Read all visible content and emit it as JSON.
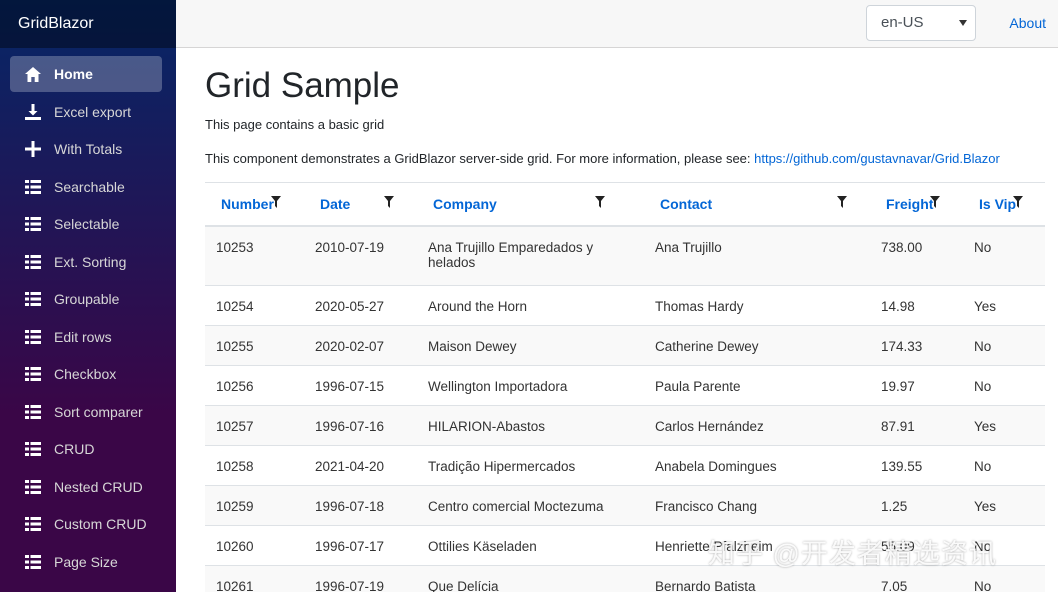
{
  "app": {
    "brand": "GridBlazor"
  },
  "sidebar": {
    "items": [
      {
        "label": "Home",
        "icon": "home-icon",
        "active": true
      },
      {
        "label": "Excel export",
        "icon": "download-icon"
      },
      {
        "label": "With Totals",
        "icon": "plus-icon"
      },
      {
        "label": "Searchable",
        "icon": "list-icon"
      },
      {
        "label": "Selectable",
        "icon": "list-icon"
      },
      {
        "label": "Ext. Sorting",
        "icon": "list-icon"
      },
      {
        "label": "Groupable",
        "icon": "list-icon"
      },
      {
        "label": "Edit rows",
        "icon": "list-icon"
      },
      {
        "label": "Checkbox",
        "icon": "list-icon"
      },
      {
        "label": "Sort comparer",
        "icon": "list-icon"
      },
      {
        "label": "CRUD",
        "icon": "list-icon"
      },
      {
        "label": "Nested CRUD",
        "icon": "list-icon"
      },
      {
        "label": "Custom CRUD",
        "icon": "list-icon"
      },
      {
        "label": "Page Size",
        "icon": "list-icon"
      }
    ]
  },
  "topbar": {
    "culture": "en-US",
    "about": "About"
  },
  "main": {
    "title": "Grid Sample",
    "intro": "This page contains a basic grid",
    "desc": "This component demonstrates a GridBlazor server-side grid. For more information, please see: ",
    "link": "https://github.com/gustavnavar/Grid.Blazor"
  },
  "grid": {
    "columns": [
      "Number",
      "Date",
      "Company",
      "Contact",
      "Freight",
      "Is Vip"
    ],
    "rows": [
      [
        "10253",
        "2010-07-19",
        "Ana Trujillo Emparedados y helados",
        "Ana Trujillo",
        "738.00",
        "No"
      ],
      [
        "10254",
        "2020-05-27",
        "Around the Horn",
        "Thomas Hardy",
        "14.98",
        "Yes"
      ],
      [
        "10255",
        "2020-02-07",
        "Maison Dewey",
        "Catherine Dewey",
        "174.33",
        "No"
      ],
      [
        "10256",
        "1996-07-15",
        "Wellington Importadora",
        "Paula Parente",
        "19.97",
        "No"
      ],
      [
        "10257",
        "1996-07-16",
        "HILARION-Abastos",
        "Carlos Hernández",
        "87.91",
        "Yes"
      ],
      [
        "10258",
        "2021-04-20",
        "Tradição Hipermercados",
        "Anabela Domingues",
        "139.55",
        "No"
      ],
      [
        "10259",
        "1996-07-18",
        "Centro comercial Moctezuma",
        "Francisco Chang",
        "1.25",
        "Yes"
      ],
      [
        "10260",
        "1996-07-17",
        "Ottilies Käseladen",
        "Henriette Pfalzheim",
        "55.09",
        "No"
      ],
      [
        "10261",
        "1996-07-19",
        "Que Delícia",
        "Bernardo Batista",
        "7.05",
        "No"
      ]
    ]
  },
  "watermark": "知乎 @开发者精选资讯"
}
